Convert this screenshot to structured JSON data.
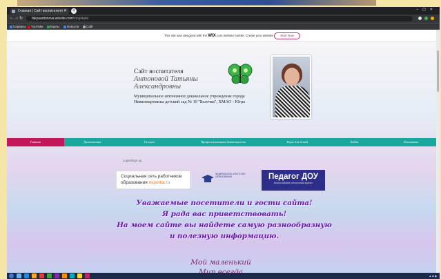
{
  "browser": {
    "tab_title": "Главная | Сайт воспитателя",
    "url_main": "fakyaantonova.wixsite.com",
    "url_path": "/vospitatel",
    "bookmarks": [
      "Сервисы",
      "YouTube",
      "Карты",
      "Новости",
      "Сайт"
    ]
  },
  "wix_banner": {
    "text": "This site was designed with the",
    "brand": "WIX",
    "text2": ".com website builder. Create your website today.",
    "button": "Start Now"
  },
  "header": {
    "line1": "Сайт воспитателя",
    "line2": "Антоновой Татьяны",
    "line3": "Александровны",
    "desc": "Муниципальное автономное дошкольное учреждение города Нижневартовска детский сад № 10 \"Белочка\", ХМАО - Югра"
  },
  "menu": [
    "Главная",
    "Достижения",
    "Галерея",
    "Профессиональная деятельность",
    "Игры для детей",
    "Хобби",
    "Контакты"
  ],
  "login": "Login/Sign up",
  "banners": {
    "nsportal_line1": "Социальная сеть работников",
    "nsportal_line2": "образования ",
    "nsportal_domain": "nsportal.ru",
    "edu_text": "ФЕДЕРАЛЬНОЕ АГЕНТСТВО ОБРАЗОВАНИЯ",
    "pedagog_title": "Педагог ДОУ",
    "pedagog_sub": "Всероссийский электронный журнал"
  },
  "welcome": [
    "Уважаемые посетители и гости сайта!",
    "Я рада вас приветствовать!",
    "На моем сайте вы найдете самую разнообразную",
    "и полезную информацию."
  ],
  "script_text": [
    "Мой маленький",
    "Мир всегда"
  ],
  "colors": {
    "accent": "#c2185b",
    "menu": "#1aa79d",
    "welcome": "#6a1aa8"
  }
}
